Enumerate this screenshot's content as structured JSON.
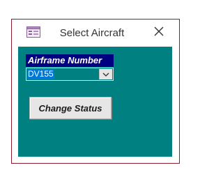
{
  "window": {
    "title": "Select Aircraft",
    "app_icon": "access-form-icon",
    "close_icon": "close-icon"
  },
  "form": {
    "airframe_label": "Airframe Number",
    "airframe_value": "DV155",
    "dropdown_icon": "chevron-down-icon",
    "change_status_label": "Change Status"
  },
  "colors": {
    "border": "#8b1a2b",
    "form_background": "#008080",
    "label_background": "#000080",
    "selection": "#0078d7",
    "button_face": "#e6e6e6"
  }
}
